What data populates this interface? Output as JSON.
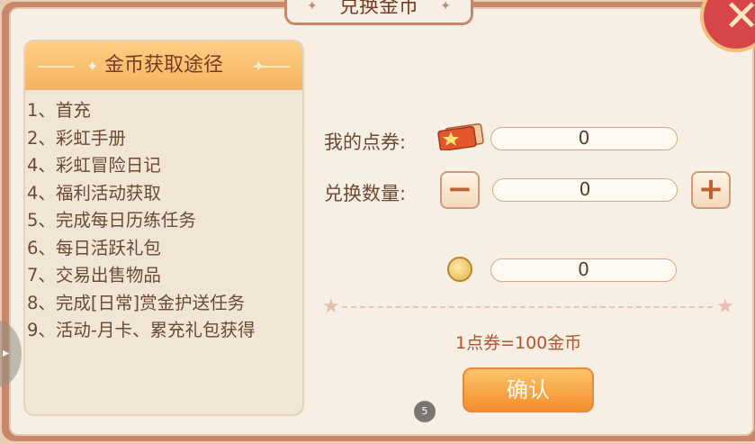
{
  "title": "兑换金币",
  "left_panel": {
    "heading": "金币获取途径",
    "items": [
      "1、首充",
      "2、彩虹手册",
      "4、彩虹冒险日记",
      "4、福利活动获取",
      "5、完成每日历练任务",
      "6、每日活跃礼包",
      "7、交易出售物品",
      "8、完成[日常]赏金护送任务",
      "9、活动-月卡、累充礼包获得"
    ]
  },
  "form": {
    "voucher_label": "我的点券:",
    "voucher_value": "0",
    "quantity_label": "兑换数量:",
    "quantity_value": "0",
    "gold_value": "0"
  },
  "rate_text": "1点券=100金币",
  "confirm_label": "确认",
  "page_indicator": "5",
  "icons": {
    "close": "close-icon",
    "minus": "minus-icon",
    "plus": "plus-icon",
    "voucher": "voucher-ticket-icon",
    "gold": "gold-coin-icon"
  },
  "colors": {
    "accent": "#f28d2e",
    "frame": "#c9876a",
    "text": "#6b4a34"
  }
}
